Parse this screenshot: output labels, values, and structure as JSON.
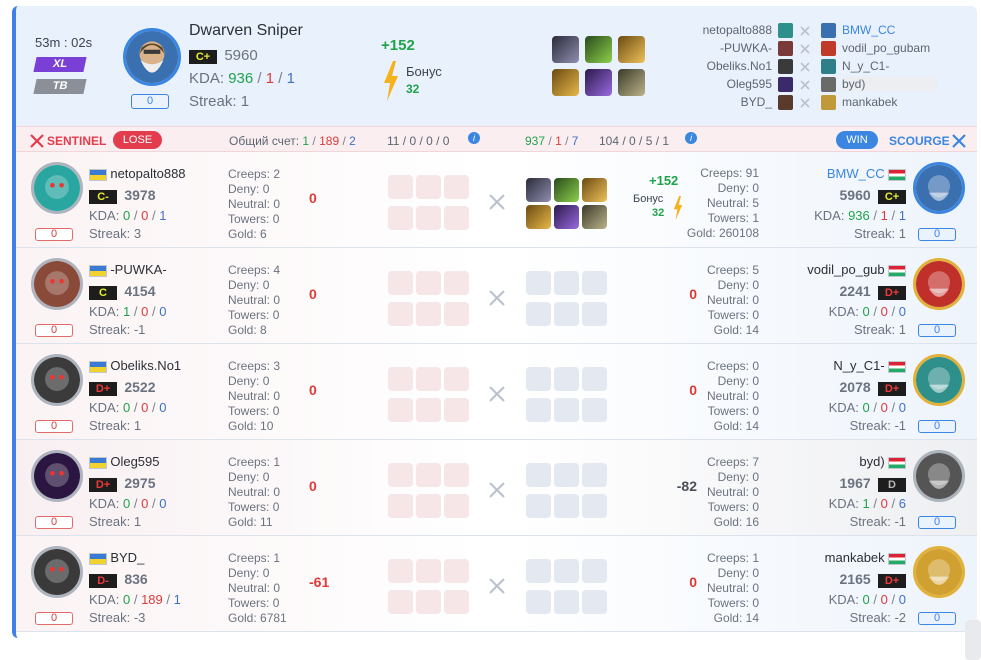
{
  "header": {
    "duration": "53m : 02s",
    "mode1": "XL",
    "mode2": "TB",
    "hero": "Dwarven Sniper",
    "grade": "C+",
    "rating": "5960",
    "kda_label": "KDA:",
    "kills": "936",
    "deaths": "1",
    "assists": "1",
    "streak_label": "Streak:",
    "streak": "1",
    "counter": "0",
    "delta": "+152",
    "bonus_label": "Бонус",
    "bonus": "32"
  },
  "mini_players": [
    {
      "left": "netopalto888",
      "right": "BMW_CC"
    },
    {
      "left": "-PUWKA-",
      "right": "vodil_po_gubam"
    },
    {
      "left": "Obeliks.No1",
      "right": "N_y_C1-"
    },
    {
      "left": "Oleg595",
      "right": "byd)"
    },
    {
      "left": "BYD_",
      "right": "mankabek"
    }
  ],
  "summary": {
    "sentinel": "SENTINEL",
    "lose": "LOSE",
    "total_label": "Общий счет:",
    "left_k": "1",
    "left_d": "189",
    "left_a": "2",
    "left_stats": "11 / 0 / 0 / 0",
    "right_k": "937",
    "right_d": "1",
    "right_a": "7",
    "right_stats": "104 / 0 / 5 / 1",
    "win": "WIN",
    "scourge": "SCOURGE"
  },
  "labels": {
    "creeps": "Creeps:",
    "deny": "Deny:",
    "neutral": "Neutral:",
    "towers": "Towers:",
    "gold": "Gold:",
    "kda": "KDA:",
    "streak": "Streak:",
    "bonus": "Бонус"
  },
  "rows": [
    {
      "l_name": "netopalto888",
      "l_grade": "C-",
      "l_rating": "3978",
      "l_k": "0",
      "l_d": "0",
      "l_a": "1",
      "l_streak": "3",
      "l_counter": "0",
      "l_creeps": "2",
      "l_deny": "0",
      "l_neutral": "0",
      "l_towers": "0",
      "l_gold": "6",
      "l_delta": "0",
      "r_name": "BMW_CC",
      "r_grade": "C+",
      "r_rating": "5960",
      "r_k": "936",
      "r_d": "1",
      "r_a": "1",
      "r_streak": "1",
      "r_counter": "0",
      "r_creeps": "91",
      "r_deny": "0",
      "r_neutral": "5",
      "r_towers": "1",
      "r_gold": "260108",
      "r_delta": "+152",
      "r_bonus": "32"
    },
    {
      "l_name": "-PUWKA-",
      "l_grade": "C",
      "l_rating": "4154",
      "l_k": "1",
      "l_d": "0",
      "l_a": "0",
      "l_streak": "-1",
      "l_counter": "0",
      "l_creeps": "4",
      "l_deny": "0",
      "l_neutral": "0",
      "l_towers": "0",
      "l_gold": "8",
      "l_delta": "0",
      "r_name": "vodil_po_gub",
      "r_grade": "D+",
      "r_rating": "2241",
      "r_k": "0",
      "r_d": "0",
      "r_a": "0",
      "r_streak": "1",
      "r_counter": "0",
      "r_creeps": "5",
      "r_deny": "0",
      "r_neutral": "0",
      "r_towers": "0",
      "r_gold": "14",
      "r_delta": "0"
    },
    {
      "l_name": "Obeliks.No1",
      "l_grade": "D+",
      "l_rating": "2522",
      "l_k": "0",
      "l_d": "0",
      "l_a": "0",
      "l_streak": "1",
      "l_counter": "0",
      "l_creeps": "3",
      "l_deny": "0",
      "l_neutral": "0",
      "l_towers": "0",
      "l_gold": "10",
      "l_delta": "0",
      "r_name": "N_y_C1-",
      "r_grade": "D+",
      "r_rating": "2078",
      "r_k": "0",
      "r_d": "0",
      "r_a": "0",
      "r_streak": "-1",
      "r_counter": "0",
      "r_creeps": "0",
      "r_deny": "0",
      "r_neutral": "0",
      "r_towers": "0",
      "r_gold": "14",
      "r_delta": "0"
    },
    {
      "l_name": "Oleg595",
      "l_grade": "D+",
      "l_rating": "2975",
      "l_k": "0",
      "l_d": "0",
      "l_a": "0",
      "l_streak": "1",
      "l_counter": "0",
      "l_creeps": "1",
      "l_deny": "0",
      "l_neutral": "0",
      "l_towers": "0",
      "l_gold": "11",
      "l_delta": "0",
      "r_name": "byd)",
      "r_grade": "D",
      "r_rating": "1967",
      "r_k": "1",
      "r_d": "0",
      "r_a": "6",
      "r_streak": "-1",
      "r_counter": "0",
      "r_creeps": "7",
      "r_deny": "0",
      "r_neutral": "0",
      "r_towers": "0",
      "r_gold": "16",
      "r_delta": "-82"
    },
    {
      "l_name": "BYD_",
      "l_grade": "D-",
      "l_rating": "836",
      "l_k": "0",
      "l_d": "189",
      "l_a": "1",
      "l_streak": "-3",
      "l_counter": "0",
      "l_creeps": "1",
      "l_deny": "0",
      "l_neutral": "0",
      "l_towers": "0",
      "l_gold": "6781",
      "l_delta": "-61",
      "r_name": "mankabek",
      "r_grade": "D+",
      "r_rating": "2165",
      "r_k": "0",
      "r_d": "0",
      "r_a": "0",
      "r_streak": "-2",
      "r_counter": "0",
      "r_creeps": "1",
      "r_deny": "0",
      "r_neutral": "0",
      "r_towers": "0",
      "r_gold": "14",
      "r_delta": "0"
    }
  ],
  "colors": {
    "accent": "#3f7fe6",
    "lose": "#e23c4d",
    "win": "#3a86e0",
    "green": "#1fa34a",
    "red": "#de3a3a"
  }
}
